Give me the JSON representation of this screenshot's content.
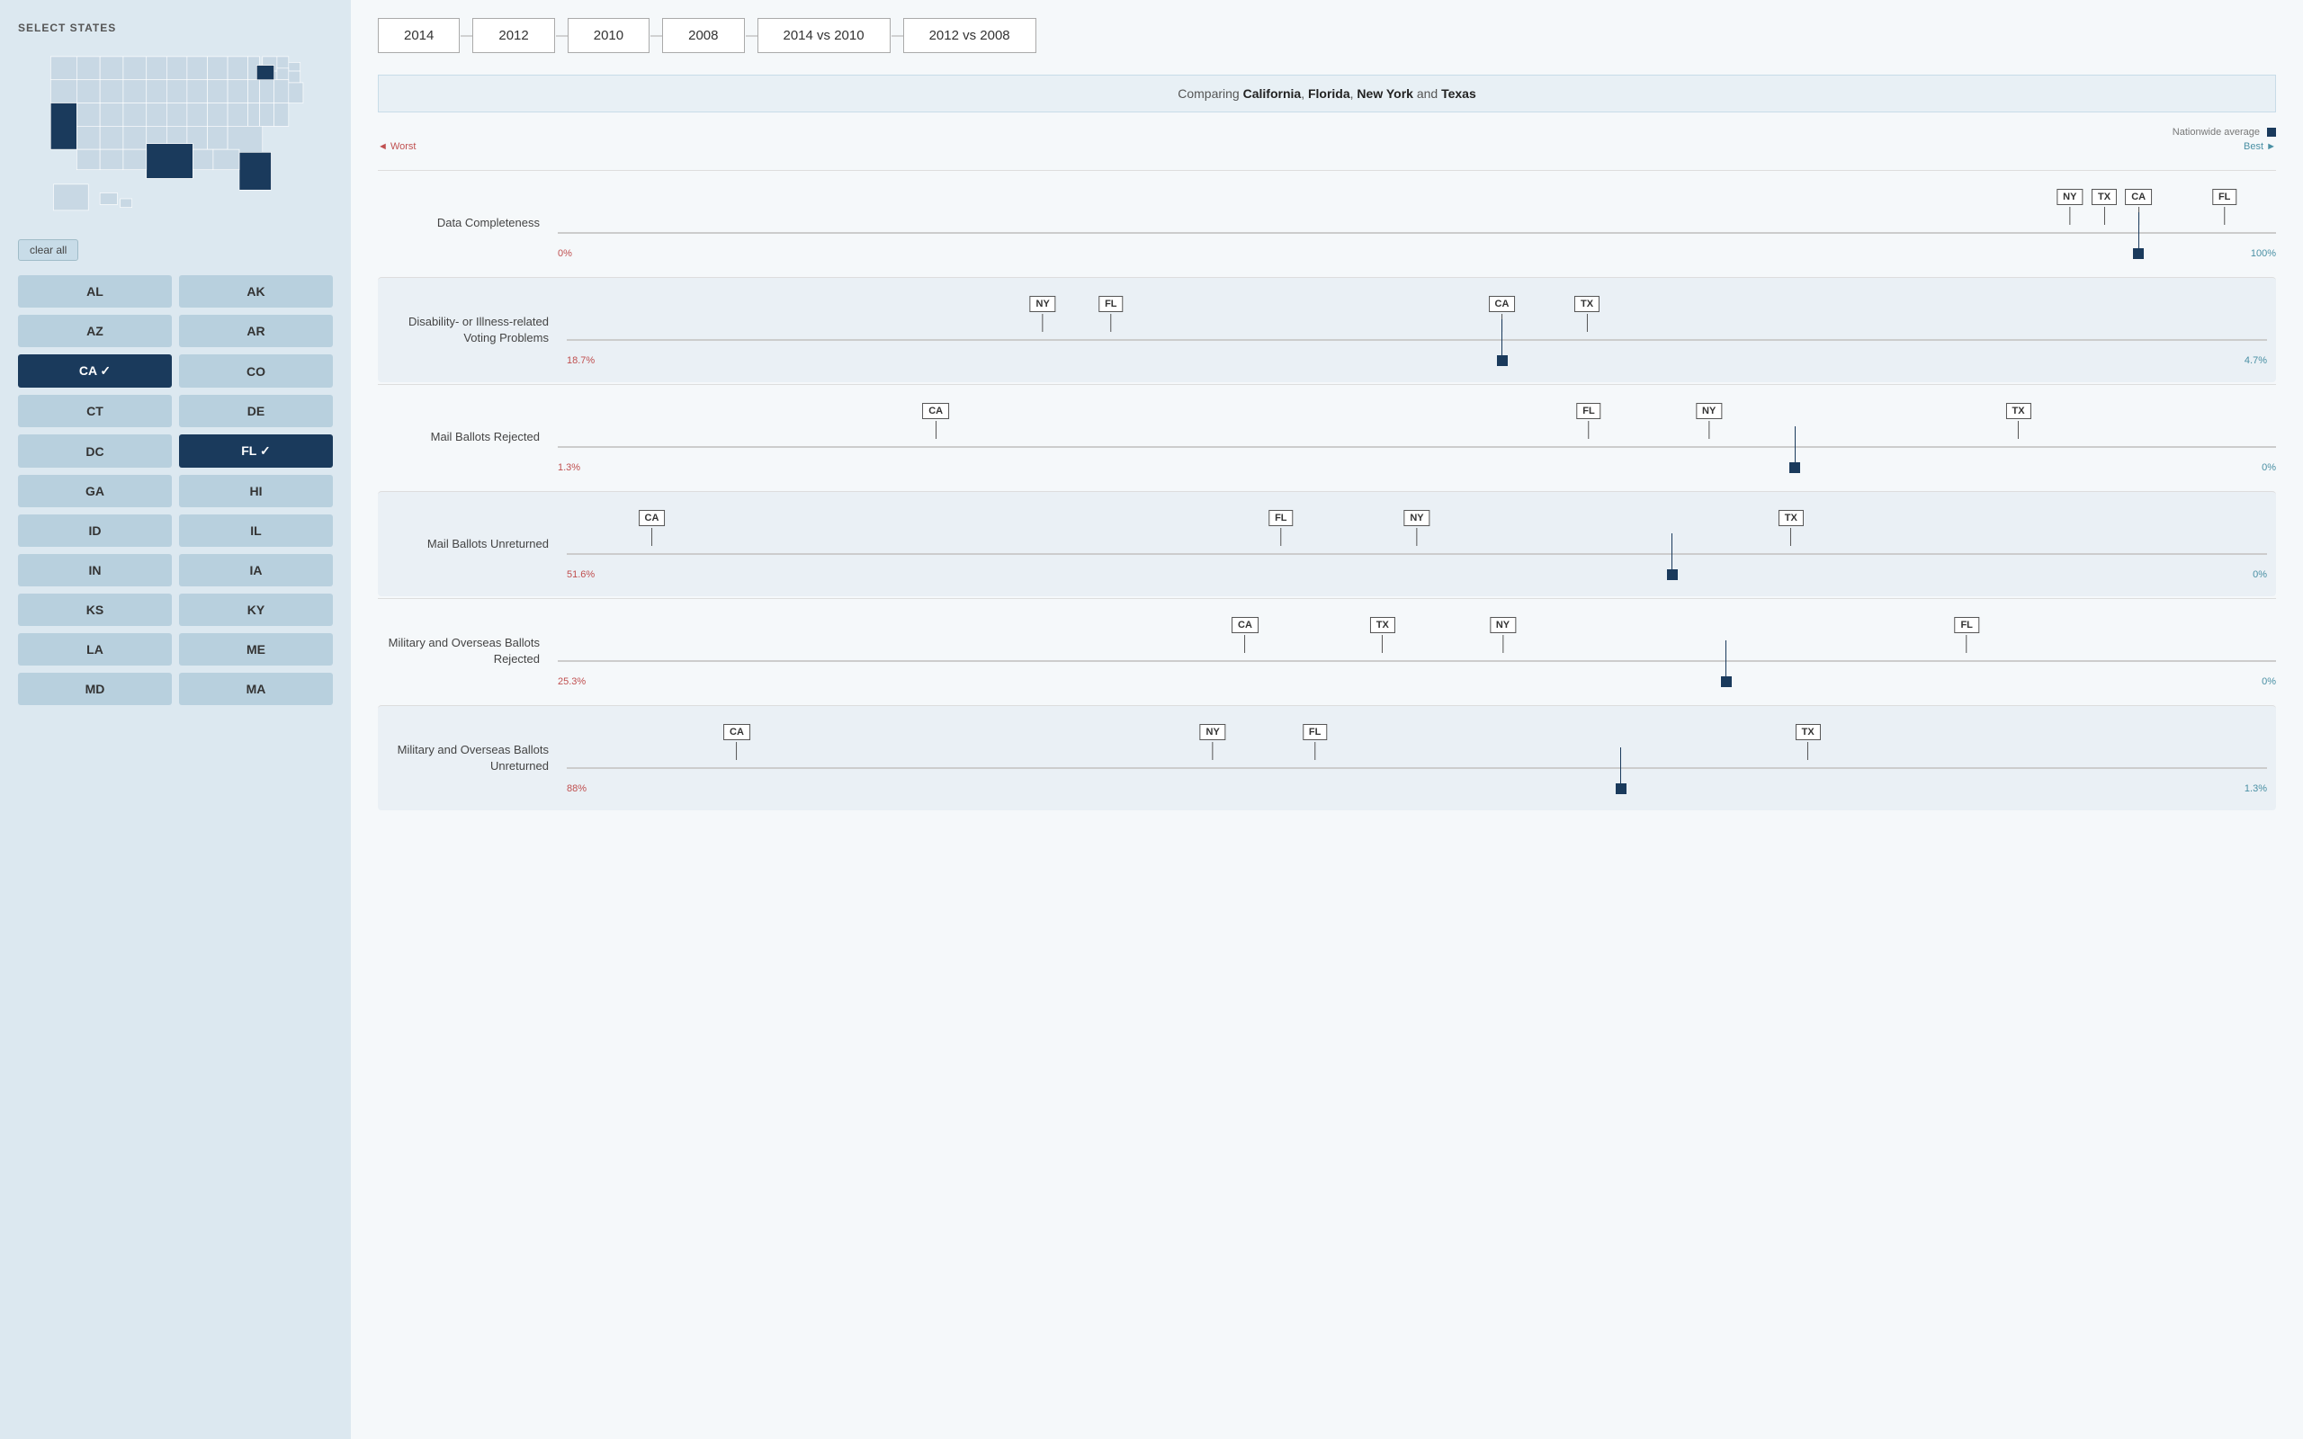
{
  "sidebar": {
    "title": "SELECT STATES",
    "clear_all_label": "clear all",
    "states": [
      {
        "code": "AL",
        "selected": false
      },
      {
        "code": "AK",
        "selected": false
      },
      {
        "code": "AZ",
        "selected": false
      },
      {
        "code": "AR",
        "selected": false
      },
      {
        "code": "CA",
        "selected": true
      },
      {
        "code": "CO",
        "selected": false
      },
      {
        "code": "CT",
        "selected": false
      },
      {
        "code": "DE",
        "selected": false
      },
      {
        "code": "DC",
        "selected": false
      },
      {
        "code": "FL",
        "selected": true
      },
      {
        "code": "GA",
        "selected": false
      },
      {
        "code": "HI",
        "selected": false
      },
      {
        "code": "ID",
        "selected": false
      },
      {
        "code": "IL",
        "selected": false
      },
      {
        "code": "IN",
        "selected": false
      },
      {
        "code": "IA",
        "selected": false
      },
      {
        "code": "KS",
        "selected": false
      },
      {
        "code": "KY",
        "selected": false
      },
      {
        "code": "LA",
        "selected": false
      },
      {
        "code": "ME",
        "selected": false
      },
      {
        "code": "MD",
        "selected": false
      },
      {
        "code": "MA",
        "selected": false
      }
    ]
  },
  "header": {
    "year_tabs": [
      "2014",
      "2012",
      "2010",
      "2008",
      "2014 vs 2010",
      "2012 vs 2008"
    ],
    "active_tab": "2014"
  },
  "compare_banner": {
    "prefix": "Comparing ",
    "states": [
      "California",
      "Florida",
      "New York",
      "Texas"
    ],
    "conjunctions": [
      ", ",
      ", ",
      " and "
    ]
  },
  "legend": {
    "nationwide_label": "Nationwide average",
    "worst_label": "◄ Worst",
    "best_label": "Best ►"
  },
  "metrics": [
    {
      "id": "data-completeness",
      "label": "Data Completeness",
      "shaded": false,
      "min_label": "0%",
      "max_label": "100%",
      "nationwide_pct": 92,
      "states": [
        {
          "code": "NY",
          "pct": 88
        },
        {
          "code": "TX",
          "pct": 90
        },
        {
          "code": "CA",
          "pct": 92
        },
        {
          "code": "FL",
          "pct": 97
        }
      ]
    },
    {
      "id": "disability-voting",
      "label": "Disability- or Illness-related Voting Problems",
      "shaded": true,
      "min_label": "18.7%",
      "max_label": "4.7%",
      "nationwide_pct": 55,
      "states": [
        {
          "code": "NY",
          "pct": 28
        },
        {
          "code": "FL",
          "pct": 32
        },
        {
          "code": "CA",
          "pct": 55
        },
        {
          "code": "TX",
          "pct": 60
        }
      ]
    },
    {
      "id": "mail-ballots-rejected",
      "label": "Mail Ballots Rejected",
      "shaded": false,
      "min_label": "1.3%",
      "max_label": "0%",
      "nationwide_pct": 72,
      "states": [
        {
          "code": "CA",
          "pct": 22
        },
        {
          "code": "FL",
          "pct": 60
        },
        {
          "code": "NY",
          "pct": 67
        },
        {
          "code": "TX",
          "pct": 85
        }
      ]
    },
    {
      "id": "mail-ballots-unreturned",
      "label": "Mail Ballots Unreturned",
      "shaded": true,
      "min_label": "51.6%",
      "max_label": "0%",
      "nationwide_pct": 65,
      "states": [
        {
          "code": "CA",
          "pct": 5
        },
        {
          "code": "FL",
          "pct": 42
        },
        {
          "code": "NY",
          "pct": 50
        },
        {
          "code": "TX",
          "pct": 72
        }
      ]
    },
    {
      "id": "military-overseas-rejected",
      "label": "Military and Overseas Ballots Rejected",
      "shaded": false,
      "min_label": "25.3%",
      "max_label": "0%",
      "nationwide_pct": 68,
      "states": [
        {
          "code": "CA",
          "pct": 40
        },
        {
          "code": "TX",
          "pct": 48
        },
        {
          "code": "NY",
          "pct": 55
        },
        {
          "code": "FL",
          "pct": 82
        }
      ]
    },
    {
      "id": "military-overseas-unreturned",
      "label": "Military and Overseas Ballots Unreturned",
      "shaded": true,
      "min_label": "88%",
      "max_label": "1.3%",
      "nationwide_pct": 62,
      "states": [
        {
          "code": "CA",
          "pct": 10
        },
        {
          "code": "NY",
          "pct": 38
        },
        {
          "code": "FL",
          "pct": 44
        },
        {
          "code": "TX",
          "pct": 73
        }
      ]
    }
  ]
}
